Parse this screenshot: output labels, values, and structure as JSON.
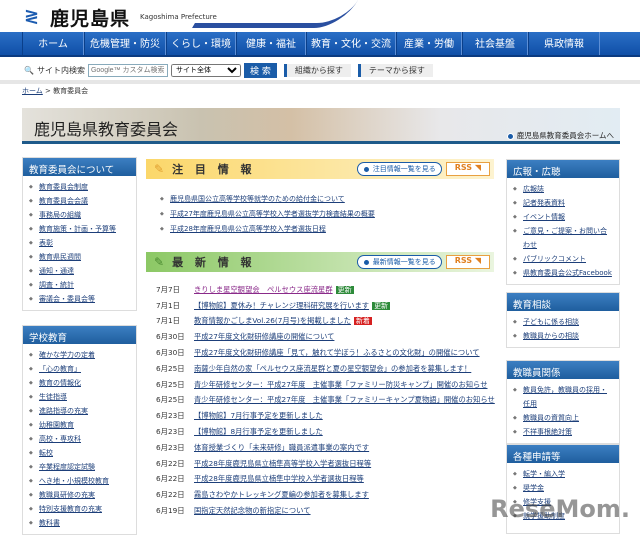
{
  "header": {
    "logo_jp": "鹿児島県",
    "logo_en": "Kagoshima Prefecture"
  },
  "nav": [
    "ホーム",
    "危機管理・防災",
    "くらし・環境",
    "健康・福祉",
    "教育・文化・交流",
    "産業・労働",
    "社会基盤",
    "県政情報"
  ],
  "search": {
    "label": "サイト内検索",
    "placeholder": "Google™ カスタム検索",
    "scope": "サイト全体",
    "button": "検 索",
    "org": "組織から探す",
    "theme": "テーマから探す"
  },
  "breadcrumb": {
    "home": "ホーム",
    "sep": " > ",
    "current": "教育委員会"
  },
  "banner": {
    "title": "鹿児島県教育委員会",
    "home_link": "鹿児島県教育委員会ホームへ"
  },
  "left": [
    {
      "title": "教育委員会について",
      "items": [
        "教育委員会制度",
        "教育委員会会議",
        "事務局の組織",
        "教育施策・計画・予算等",
        "表彰",
        "教育県民週間",
        "通知・通達",
        "調査・統計",
        "審議会・委員会等"
      ]
    },
    {
      "title": "学校教育",
      "items": [
        "確かな学力の定着",
        "「心の教育」",
        "教育の情報化",
        "生徒指導",
        "進路指導の充実",
        "幼稚園教育",
        "高校・専攻科",
        "転校",
        "卒業程度認定試験",
        "へき地・小規模校教育",
        "教職員研修の充実",
        "特別支援教育の充実",
        "教科書"
      ]
    }
  ],
  "attention": {
    "title": "注 目 情 報",
    "list_link": "注目情報一覧を見る",
    "rss": "RSS",
    "items": [
      "鹿児島県国公立高等学校等就学のための給付金について",
      "平成27年度鹿児島県公立高等学校入学者選抜学力検査結果の概要",
      "平成28年度鹿児島県公立高等学校入学者選抜日程"
    ]
  },
  "latest": {
    "title": "最 新 情 報",
    "list_link": "最新情報一覧を見る",
    "rss": "RSS",
    "items": [
      {
        "date": "7月7日",
        "title": "きりしま星空観望会　ペルセウス座流星群",
        "badge": "更新",
        "badge_color": "#2e8b3a"
      },
      {
        "date": "7月1日",
        "title": "【博物館】夏休み！チャレンジ理科研究展を行います",
        "badge": "更新",
        "badge_color": "#2e8b3a"
      },
      {
        "date": "7月1日",
        "title": "教育情報かごしまVol.26(7月号)を掲載しました",
        "badge": "新着",
        "badge_color": "#d62020"
      },
      {
        "date": "6月30日",
        "title": "平成27年度文化財研修講座の開催について"
      },
      {
        "date": "6月30日",
        "title": "平成27年度文化財研修講座「見て，触れて学ぼう！ふるさとの文化財」の開催について"
      },
      {
        "date": "6月25日",
        "title": "南薩少年自然の家「ペルセウス座流星群と夏の星空観望会」の参加者を募集します！"
      },
      {
        "date": "6月25日",
        "title": "青少年研修センター：平成27年度　主催事業「ファミリー防災キャンプ」開催のお知らせ"
      },
      {
        "date": "6月25日",
        "title": "青少年研修センター：平成27年度　主催事業「ファミリーキャンプ夏物語」開催のお知らせ"
      },
      {
        "date": "6月23日",
        "title": "【博物館】7月行事予定を更新しました"
      },
      {
        "date": "6月23日",
        "title": "【博物館】8月行事予定を更新しました"
      },
      {
        "date": "6月23日",
        "title": "体育授業づくり「未来研修」職員派遣事業の案内です"
      },
      {
        "date": "6月22日",
        "title": "平成28年度鹿児島県立楠隼高等学校入学者選抜日程等"
      },
      {
        "date": "6月22日",
        "title": "平成28年度鹿児島県立楠隼中学校入学者選抜日程等"
      },
      {
        "date": "6月22日",
        "title": "霧島さわやかトレッキング夏編の参加者を募集します"
      },
      {
        "date": "6月19日",
        "title": "国指定天然記念物の新指定について"
      }
    ]
  },
  "right": [
    {
      "title": "広報・広聴",
      "items": [
        "広報誌",
        "記者発表資料",
        "イベント情報",
        "ご意見・ご提案・お問い合わせ",
        "パブリックコメント",
        "県教育委員会公式Facebook"
      ]
    },
    {
      "title": "教育相談",
      "items": [
        "子どもに係る相談",
        "教職員からの相談"
      ]
    },
    {
      "title": "教職員関係",
      "items": [
        "教員免許，教職員の採用・任用",
        "教職員の資質向上",
        "不祥事根絶対策"
      ]
    },
    {
      "title": "各種申請等",
      "items": [
        "転学・編入学",
        "奨学金",
        "修学支援",
        "就学援助制度"
      ]
    }
  ],
  "watermark": "ReseMom"
}
